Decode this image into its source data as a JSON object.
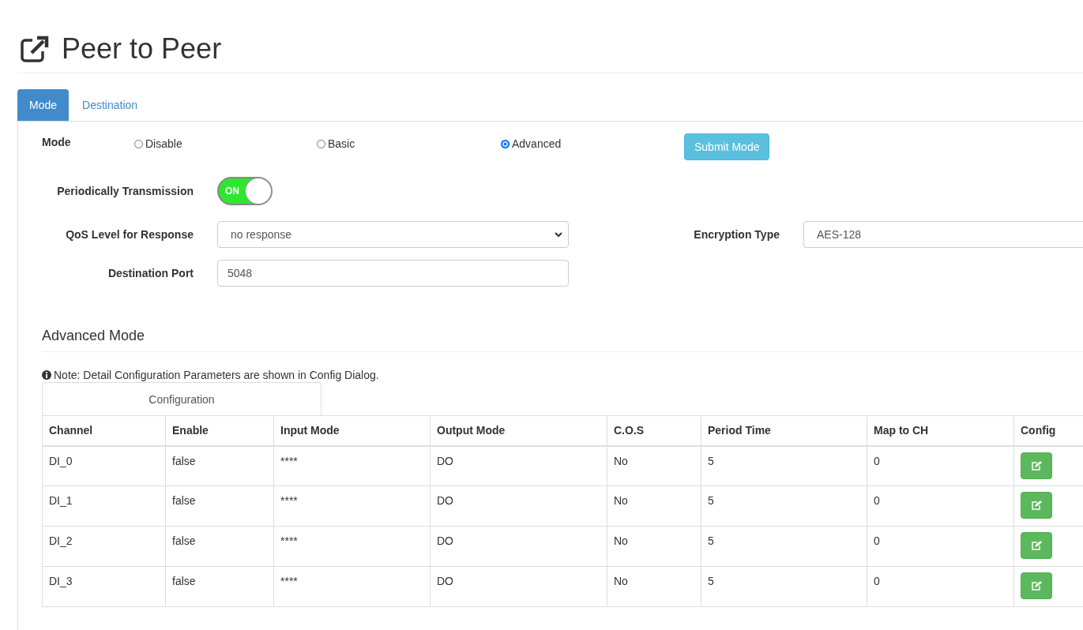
{
  "page": {
    "title": "Peer to Peer"
  },
  "tabs": [
    {
      "label": "Mode",
      "selected": true
    },
    {
      "label": "Destination",
      "selected": false
    }
  ],
  "mode": {
    "label": "Mode",
    "options": [
      {
        "label": "Disable",
        "selected": false
      },
      {
        "label": "Basic",
        "selected": false
      },
      {
        "label": "Advanced",
        "selected": true
      }
    ],
    "submit": "Submit Mode"
  },
  "periodic": {
    "label": "Periodically Transmission",
    "on": true,
    "text": "ON"
  },
  "qos": {
    "label": "QoS Level for Response",
    "value": "no response"
  },
  "encryption": {
    "label": "Encryption Type",
    "value": "AES-128"
  },
  "port": {
    "label": "Destination Port",
    "value": "5048"
  },
  "advanced": {
    "heading": "Advanced Mode",
    "note": "Note: Detail Configuration Parameters are shown in Config Dialog.",
    "subtab": "Configuration"
  },
  "table": {
    "columns": [
      "Channel",
      "Enable",
      "Input Mode",
      "Output Mode",
      "C.O.S",
      "Period Time",
      "Map to CH",
      "Config"
    ],
    "rows": [
      {
        "cells": [
          "DI_0",
          "false",
          "****",
          "DO",
          "No",
          "5",
          "0"
        ]
      },
      {
        "cells": [
          "DI_1",
          "false",
          "****",
          "DO",
          "No",
          "5",
          "0"
        ]
      },
      {
        "cells": [
          "DI_2",
          "false",
          "****",
          "DO",
          "No",
          "5",
          "0"
        ]
      },
      {
        "cells": [
          "DI_3",
          "false",
          "****",
          "DO",
          "No",
          "5",
          "0"
        ]
      }
    ]
  }
}
